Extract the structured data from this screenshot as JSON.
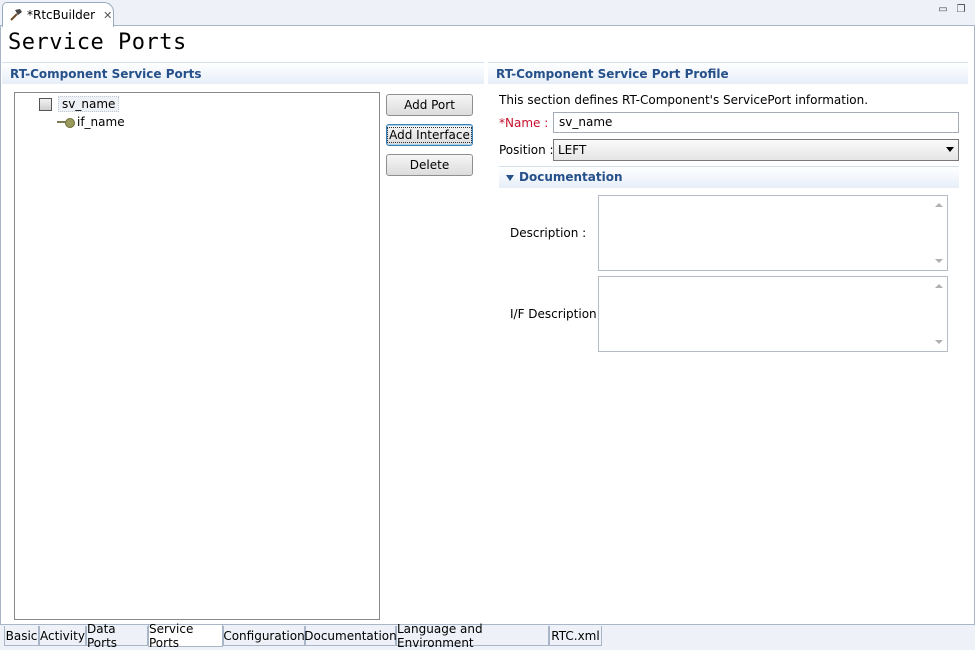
{
  "editor": {
    "tab_title": "*RtcBuilder",
    "page_title": "Service Ports"
  },
  "left_section": {
    "title": "RT-Component Service Ports",
    "tree": {
      "port_name": "sv_name",
      "interface_name": "if_name"
    },
    "buttons": {
      "add_port": "Add Port",
      "add_interface": "Add Interface",
      "delete": "Delete"
    }
  },
  "right_section": {
    "title": "RT-Component Service Port Profile",
    "intro": "This section defines RT-Component's ServicePort information.",
    "name_label": "*Name :",
    "name_value": "sv_name",
    "position_label": "Position :",
    "position_value": "LEFT",
    "documentation": {
      "title": "Documentation",
      "description_label": "Description :",
      "if_description_label": "I/F Description :"
    }
  },
  "page_tabs": [
    {
      "label": "Basic"
    },
    {
      "label": "Activity"
    },
    {
      "label": "Data Ports"
    },
    {
      "label": "Service Ports"
    },
    {
      "label": "Configuration"
    },
    {
      "label": "Documentation"
    },
    {
      "label": "Language and Environment"
    },
    {
      "label": "RTC.xml"
    }
  ],
  "colors": {
    "section_title": "#26508a",
    "required_label": "#c8102e"
  }
}
